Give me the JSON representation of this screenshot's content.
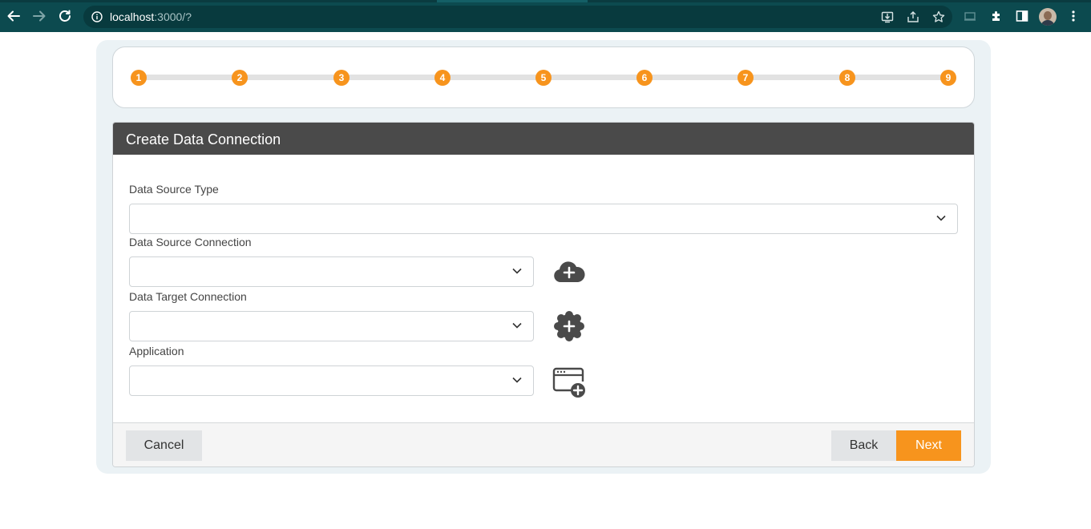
{
  "browser": {
    "url_host": "localhost",
    "url_rest": ":3000/?"
  },
  "stepper": {
    "steps": [
      "1",
      "2",
      "3",
      "4",
      "5",
      "6",
      "7",
      "8",
      "9"
    ]
  },
  "card": {
    "title": "Create Data Connection",
    "fields": {
      "data_source_type": {
        "label": "Data Source Type",
        "value": ""
      },
      "data_source_connection": {
        "label": "Data Source Connection",
        "value": ""
      },
      "data_target_connection": {
        "label": "Data Target Connection",
        "value": ""
      },
      "application": {
        "label": "Application",
        "value": ""
      }
    },
    "icons": {
      "source_add": "cloud-plus-icon",
      "target_add": "badge-plus-icon",
      "application_add": "window-plus-icon"
    }
  },
  "footer": {
    "cancel_label": "Cancel",
    "back_label": "Back",
    "next_label": "Next"
  },
  "colors": {
    "accent": "#f7941d",
    "chrome": "#0c4a4f",
    "header": "#4a4a4a"
  }
}
